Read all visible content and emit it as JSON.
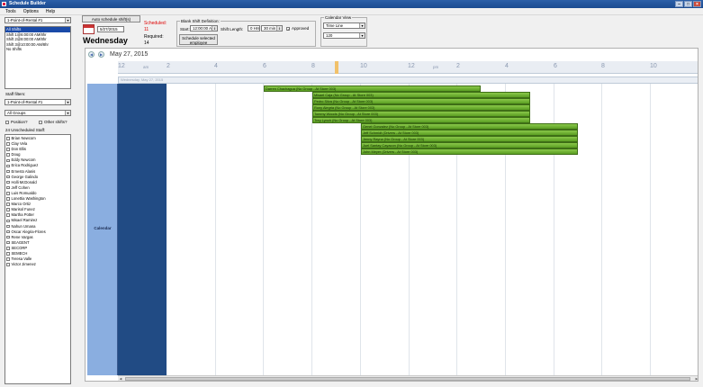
{
  "window": {
    "title": "Schedule Builder"
  },
  "menu": [
    "Tools",
    "Options",
    "Help"
  ],
  "left": {
    "location": "1-Point-of-Rental #1",
    "shifts": [
      "All Shifts",
      "Shift 1@6:00:00 AM/8hr",
      "Shift 2@8:00:00 AM/8hr",
      "Shift 3@10:00:00 AM/8hr",
      "No Shifts"
    ],
    "staff_filters_label": "Staff filters:",
    "filter_location": "1-Point-of-Rental #1",
    "filter_group": "All Groups",
    "position_label": "Position?",
    "other_shifts_label": "Other shifts?",
    "unscheduled_label": "24 Unscheduled Staff:",
    "staff": [
      "Brian Newcom",
      "Clay Vela",
      "Don Ellis",
      "Doug",
      "Eddy Newcom",
      "Erica Rodriguez",
      "Ernesto Alanis",
      "George Galindo",
      "Holli McDonald",
      "Jeff Cohen",
      "Luis Romualdo",
      "Lonettia Washington",
      "Marco Ortiz",
      "Marisol Funez",
      "Martha Potter",
      "Misael Ramirez",
      "Nahun Umana",
      "Oscar Alegria-Flores",
      "Rene Vargas",
      "SEAGENT",
      "SECORP",
      "SEMECH",
      "Teresa Valle",
      "Victor Jimenez"
    ]
  },
  "top": {
    "auto_button": "Auto schedule shift(s)",
    "date_value": "5/27/2015",
    "day_name": "Wednesday",
    "scheduled_label": "Scheduled:",
    "scheduled_count": "11",
    "required_label": "Required:",
    "required_count": "14",
    "blank_shift_title": "Blank Shift Definition:",
    "start_label": "Start:",
    "start_value": "12:00:00 AM",
    "shift_length_label": "Shift Length:",
    "shift_hrs": "0 Hrs",
    "shift_min": "30 min",
    "approved_label": "Approved",
    "schedule_button": "Schedule selected employee",
    "calendar_view_title": "Calendar View",
    "view_mode": "Time Line",
    "zoom": "120"
  },
  "calendar": {
    "date_title": "May 27, 2015",
    "day_header": "Wednesday, May 27, 2015",
    "side_label": "Calendar",
    "hours": [
      "12",
      "2",
      "4",
      "6",
      "8",
      "10",
      "12",
      "2",
      "4",
      "6",
      "8",
      "10"
    ],
    "ampm": [
      "am",
      "pm"
    ],
    "bars": [
      "Darren Chachagua (No Group - At Store 003)",
      "Misael Caja (No Group - At Store 003)",
      "Pedro Silva (No Group - At Store 003)",
      "Rony Alegria (No Group - At Store 003)",
      "Tommy Woods (No Group - At Store 003)",
      "Trey Lynch (No Group - At Store 003)",
      "Genel Gonzalez (No Group - At Store 003)",
      "Jeff Schmidt (Drivers - At Store 003)",
      "Jenny Rayna (No Group - At Store 003)",
      "Juel Santay Cayacon (No Group - At Store 003)",
      "John Meyer (Drivers - At Store 003)"
    ]
  }
}
